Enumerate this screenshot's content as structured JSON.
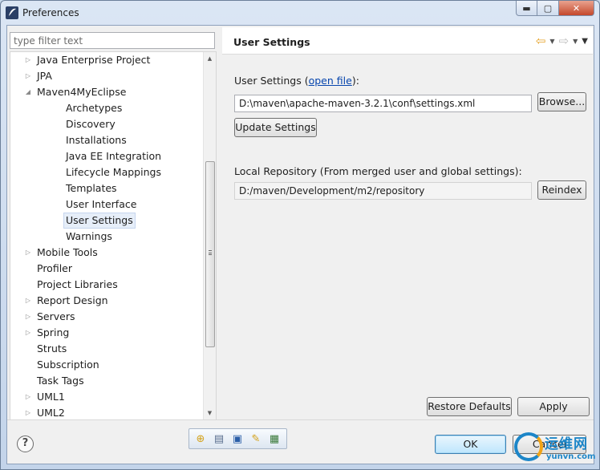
{
  "window": {
    "title": "Preferences",
    "minimize_glyph": "▬",
    "maximize_glyph": "▢",
    "close_glyph": "✕"
  },
  "filter": {
    "placeholder": "type filter text"
  },
  "tree": {
    "items": [
      {
        "label": "Java Enterprise Project",
        "arrow": "▷"
      },
      {
        "label": "JPA",
        "arrow": "▷"
      },
      {
        "label": "Maven4MyEclipse",
        "arrow": "◢"
      },
      {
        "label": "Archetypes",
        "arrow": ""
      },
      {
        "label": "Discovery",
        "arrow": ""
      },
      {
        "label": "Installations",
        "arrow": ""
      },
      {
        "label": "Java EE Integration",
        "arrow": ""
      },
      {
        "label": "Lifecycle Mappings",
        "arrow": ""
      },
      {
        "label": "Templates",
        "arrow": ""
      },
      {
        "label": "User Interface",
        "arrow": ""
      },
      {
        "label": "User Settings",
        "arrow": "",
        "selected": true
      },
      {
        "label": "Warnings",
        "arrow": ""
      },
      {
        "label": "Mobile Tools",
        "arrow": "▷"
      },
      {
        "label": "Profiler",
        "arrow": ""
      },
      {
        "label": "Project Libraries",
        "arrow": ""
      },
      {
        "label": "Report Design",
        "arrow": "▷"
      },
      {
        "label": "Servers",
        "arrow": "▷"
      },
      {
        "label": "Spring",
        "arrow": "▷"
      },
      {
        "label": "Struts",
        "arrow": ""
      },
      {
        "label": "Subscription",
        "arrow": ""
      },
      {
        "label": "Task Tags",
        "arrow": ""
      },
      {
        "label": "UML1",
        "arrow": "▷"
      },
      {
        "label": "UML2",
        "arrow": "▷"
      }
    ],
    "scroll_up_glyph": "▲",
    "scroll_down_glyph": "▼"
  },
  "page": {
    "title": "User Settings",
    "nav_back_glyph": "⇦",
    "nav_forward_glyph": "⇨",
    "dropdown_glyph": "▼",
    "user_settings_label_prefix": "User Settings (",
    "open_file_link": "open file",
    "user_settings_label_suffix": "):",
    "settings_path": "D:\\maven\\apache-maven-3.2.1\\conf\\settings.xml",
    "browse_button": "Browse...",
    "update_button": "Update Settings",
    "local_repo_label": "Local Repository (From merged user and global settings):",
    "local_repo_path": "D:/maven/Development/m2/repository",
    "reindex_button": "Reindex",
    "restore_defaults_button": "Restore Defaults",
    "apply_button": "Apply"
  },
  "footer": {
    "help_glyph": "?",
    "ok_button": "OK",
    "cancel_button": "Cancel",
    "toolbar_icons": [
      "⊕",
      "▤",
      "▣",
      "✎",
      "▦"
    ]
  },
  "watermark": {
    "big": "运维网",
    "small": "yunvn.com"
  },
  "colors": {
    "link": "#0645ad",
    "primary_border": "#3c7fb1",
    "selection": "#e6eef9"
  }
}
